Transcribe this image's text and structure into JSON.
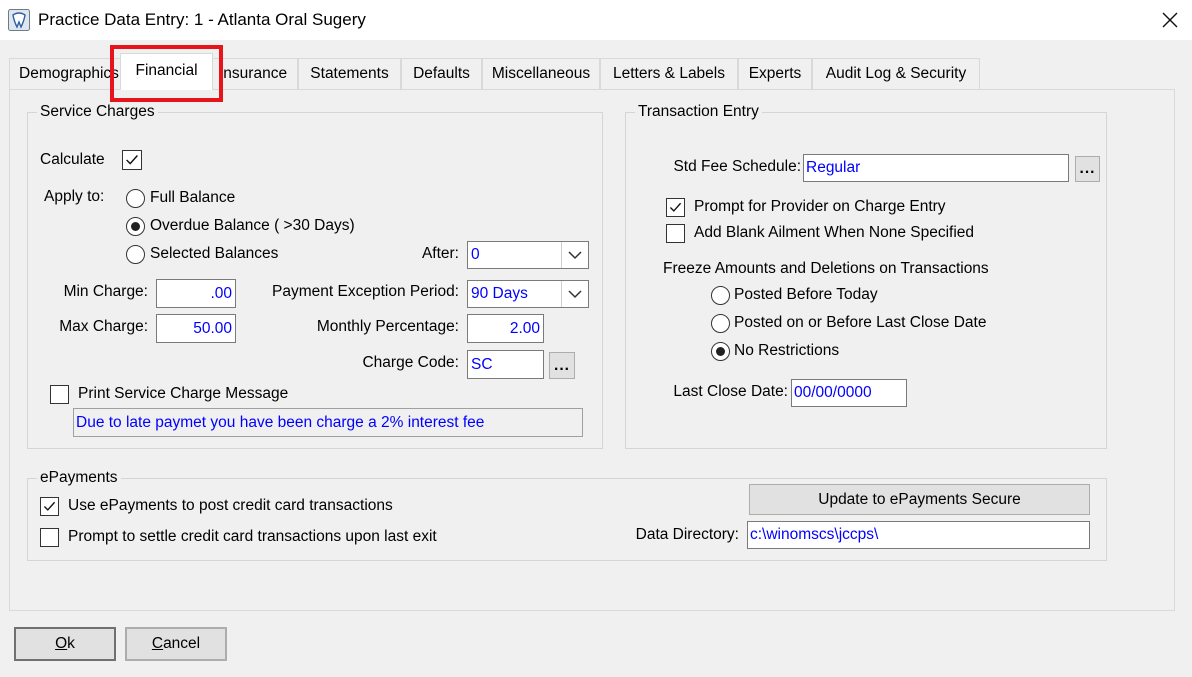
{
  "window": {
    "title": "Practice Data Entry: 1 - Atlanta Oral Sugery",
    "icon": "app-icon",
    "close_icon": "close-icon"
  },
  "tabs": {
    "items": [
      "Demographics",
      "Financial",
      "Insurance",
      "Statements",
      "Defaults",
      "Miscellaneous",
      "Letters & Labels",
      "Experts",
      "Audit Log & Security"
    ],
    "selected": "Financial"
  },
  "service_charges": {
    "title": "Service Charges",
    "calculate_label": "Calculate",
    "calculate_checked": true,
    "apply_to_label": "Apply to:",
    "apply_options": [
      {
        "label": "Full Balance",
        "selected": false
      },
      {
        "label": "Overdue Balance ( >30 Days)",
        "selected": true
      },
      {
        "label": "Selected Balances",
        "selected": false
      }
    ],
    "after_label": "After:",
    "after_value": "0",
    "min_charge_label": "Min Charge:",
    "min_charge_value": ".00",
    "payment_exception_label": "Payment Exception Period:",
    "payment_exception_value": "90 Days",
    "max_charge_label": "Max Charge:",
    "max_charge_value": "50.00",
    "monthly_percentage_label": "Monthly Percentage:",
    "monthly_percentage_value": "2.00",
    "charge_code_label": "Charge Code:",
    "charge_code_value": "SC",
    "browse_label": "...",
    "print_message_label": "Print Service Charge Message",
    "print_message_checked": false,
    "message_value": "Due to late paymet you have been charge a 2% interest fee"
  },
  "transaction_entry": {
    "title": "Transaction Entry",
    "std_fee_label": "Std Fee Schedule:",
    "std_fee_value": "Regular",
    "browse_label": "...",
    "prompt_provider_label": "Prompt for Provider on Charge Entry",
    "prompt_provider_checked": true,
    "add_blank_label": "Add Blank Ailment When None Specified",
    "add_blank_checked": false,
    "freeze_label": "Freeze Amounts and Deletions on Transactions",
    "freeze_options": [
      {
        "label": "Posted Before Today",
        "selected": false
      },
      {
        "label": "Posted on or Before Last Close Date",
        "selected": false
      },
      {
        "label": "No Restrictions",
        "selected": true
      }
    ],
    "last_close_label": "Last Close Date:",
    "last_close_value": "00/00/0000"
  },
  "epayments": {
    "title": "ePayments",
    "use_label": "Use ePayments to post credit card transactions",
    "use_checked": true,
    "prompt_settle_label": "Prompt to settle credit card transactions upon last exit",
    "prompt_settle_checked": false,
    "update_button_label": "Update to ePayments Secure",
    "data_directory_label": "Data Directory:",
    "data_directory_value": "c:\\winomscs\\jccps\\"
  },
  "footer": {
    "ok_label": "Ok",
    "cancel_label": "Cancel"
  },
  "colors": {
    "input_text": "#0000ff",
    "highlight": "#e8141b",
    "background": "#f0f0f0"
  }
}
